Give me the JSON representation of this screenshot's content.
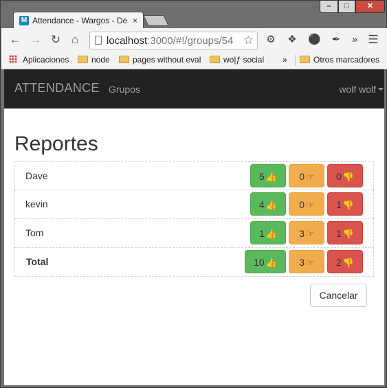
{
  "browser": {
    "tab_title": "Attendance - Wargos - De",
    "tab_favicon": "M",
    "tab_close": "×",
    "url_host": "localhost",
    "url_rest": ":3000/#!/groups/54",
    "window_controls": {
      "minimize": "–",
      "maximize": "□",
      "close": "✕"
    },
    "bookmarks": {
      "apps": "Aplicaciones",
      "items": [
        "node",
        "pages without eval",
        "wo|ƒ social"
      ],
      "overflow": "»",
      "other": "Otros marcadores"
    },
    "extensions_overflow": "»"
  },
  "navbar": {
    "brand": "ATTENDANCE",
    "link": "Grupos",
    "user": "wolf wolf"
  },
  "page": {
    "title": "Reportes",
    "rows": [
      {
        "name": "Dave",
        "present": "5",
        "late": "0",
        "absent": "0"
      },
      {
        "name": "kevin",
        "present": "4",
        "late": "0",
        "absent": "1"
      },
      {
        "name": "Tom",
        "present": "1",
        "late": "3",
        "absent": "1"
      }
    ],
    "total": {
      "name": "Total",
      "present": "10",
      "late": "3",
      "absent": "2"
    },
    "cancel_label": "Cancelar"
  },
  "colors": {
    "present": "#5cb85c",
    "late": "#f0ad4e",
    "absent": "#d9534f",
    "navbar": "#222222"
  },
  "icons": {
    "present": "thumbs-up-icon",
    "late": "hand-point-right-icon",
    "absent": "thumbs-down-icon"
  }
}
